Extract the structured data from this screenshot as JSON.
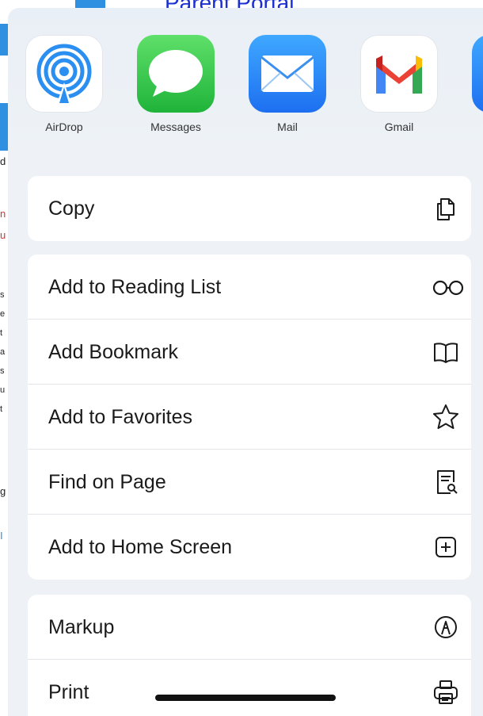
{
  "background": {
    "title": "Parent Portal",
    "accent_color": "#2f8fe0",
    "red_color": "#e0312e",
    "letters": [
      "d",
      "n",
      "u",
      "s",
      "e",
      "t",
      "a",
      "s",
      "u",
      "t",
      "g",
      "I"
    ]
  },
  "share_targets": [
    {
      "name": "AirDrop",
      "icon": "airdrop-icon"
    },
    {
      "name": "Messages",
      "icon": "messages-icon"
    },
    {
      "name": "Mail",
      "icon": "mail-icon"
    },
    {
      "name": "Gmail",
      "icon": "gmail-icon"
    }
  ],
  "actions": {
    "group1": [
      {
        "label": "Copy",
        "icon": "copy-icon"
      }
    ],
    "group2": [
      {
        "label": "Add to Reading List",
        "icon": "glasses-icon"
      },
      {
        "label": "Add Bookmark",
        "icon": "book-icon"
      },
      {
        "label": "Add to Favorites",
        "icon": "star-icon"
      },
      {
        "label": "Find on Page",
        "icon": "find-on-page-icon"
      },
      {
        "label": "Add to Home Screen",
        "icon": "plus-square-icon"
      }
    ],
    "group3": [
      {
        "label": "Markup",
        "icon": "markup-pen-icon"
      },
      {
        "label": "Print",
        "icon": "printer-icon"
      }
    ]
  }
}
